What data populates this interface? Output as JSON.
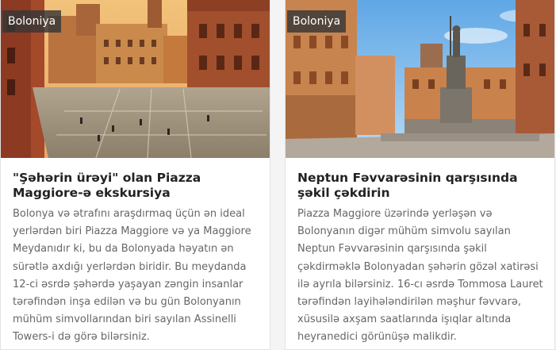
{
  "cards": [
    {
      "badge": "Boloniya",
      "title": "\"Şəhərin ürəyi\" olan Piazza Maggiore-ə ekskursiya",
      "description": "Bolonya və ətrafını araşdırmaq üçün ən ideal yerlərdən biri Piazza Maggiore və ya Maggiore Meydanıdır ki, bu da Bolonyada həyatın ən sürətlə axdığı yerlərdən biridir. Bu meydanda 12-ci əsrdə şəhərdə yaşayan zəngin insanlar tərəfindən inşa edilən və bu gün Bolonyanın mühüm simvollarından biri sayılan Assinelli Towers-i də görə bilərsiniz."
    },
    {
      "badge": "Boloniya",
      "title": "Neptun Fəvvarəsinin qarşısında şəkil çəkdirin",
      "description": "Piazza Maggiore üzərində yerləşən və Bolonyanın digər mühüm simvolu sayılan Neptun Fəvvarəsinin qarşısında şəkil çəkdirməklə Bolonyadan şəhərin gözəl xatirəsi ilə ayrıla bilərsiniz. 16-cı əsrdə Tommosa Lauret tərəfindən layihələndirilən məşhur fəvvarə, xüsusilə axşam saatlarında işıqlar altında heyranedici görünüşə malikdir."
    }
  ]
}
